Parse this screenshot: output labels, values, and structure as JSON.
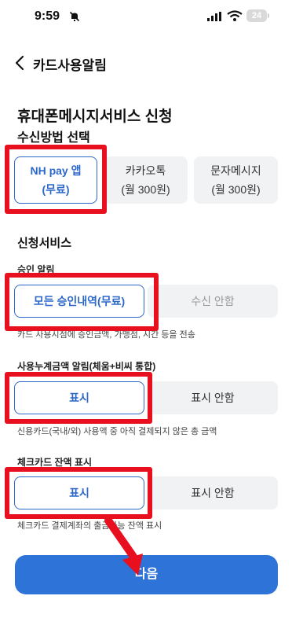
{
  "status": {
    "time": "9:59",
    "battery": "24"
  },
  "header": {
    "back_icon": "chevron-left-icon",
    "title": "카드사용알림"
  },
  "page": {
    "title": "휴대폰메시지서비스 신청",
    "subtitle": "수신방법 선택"
  },
  "receive_methods": [
    {
      "line1": "NH pay 앱",
      "line2": "(무료)",
      "selected": true
    },
    {
      "line1": "카카오톡",
      "line2": "(월 300원)",
      "selected": false
    },
    {
      "line1": "문자메시지",
      "line2": "(월 300원)",
      "selected": false
    }
  ],
  "services": {
    "heading": "신청서비스",
    "approval": {
      "label": "승인 알림",
      "options": [
        "모든 승인내역(무료)",
        "수신 안함"
      ],
      "selected": 0,
      "desc": "카드 사용시점에 승인금액, 가맹점, 시간 등을 전송"
    },
    "cumulative": {
      "label": "사용누계금액 알림(체움+비씨 통합)",
      "options": [
        "표시",
        "표시 안함"
      ],
      "selected": 0,
      "desc": "신용카드(국내/외) 사용액 중 아직 결제되지 않은 총 금액"
    },
    "check_balance": {
      "label": "체크카드 잔액 표시",
      "options": [
        "표시",
        "표시 안함"
      ],
      "selected": 0,
      "desc": "체크카드 결제계좌의 출금가능 잔액 표시"
    }
  },
  "footer": {
    "next_label": "다음"
  },
  "colors": {
    "accent": "#2c68c9",
    "button": "#2d73d8",
    "highlight": "#e8101e"
  }
}
